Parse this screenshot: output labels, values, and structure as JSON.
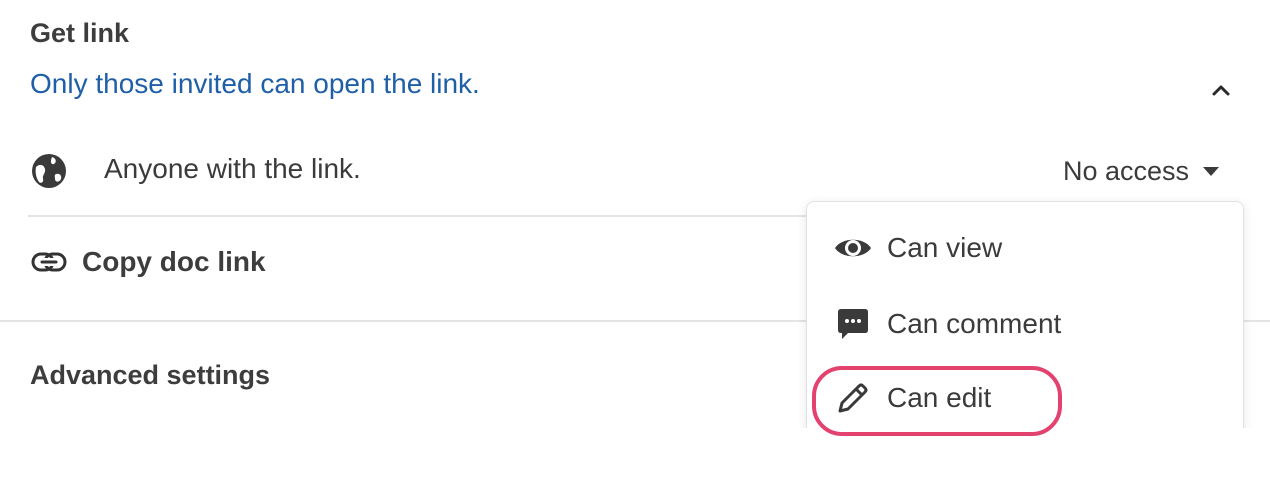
{
  "get_link": {
    "title": "Get link",
    "status": "Only those invited can open the link."
  },
  "anyone": {
    "label": "Anyone with the link.",
    "access_value": "No access"
  },
  "copy": {
    "label": "Copy doc link"
  },
  "advanced": {
    "label": "Advanced settings"
  },
  "access_menu": {
    "items": [
      {
        "label": "Can view",
        "icon": "eye-icon"
      },
      {
        "label": "Can comment",
        "icon": "comment-icon"
      },
      {
        "label": "Can edit",
        "icon": "pencil-icon"
      }
    ]
  },
  "colors": {
    "link_blue": "#1f5fa8",
    "highlight": "#e3426f",
    "text": "#3b3b3b"
  }
}
